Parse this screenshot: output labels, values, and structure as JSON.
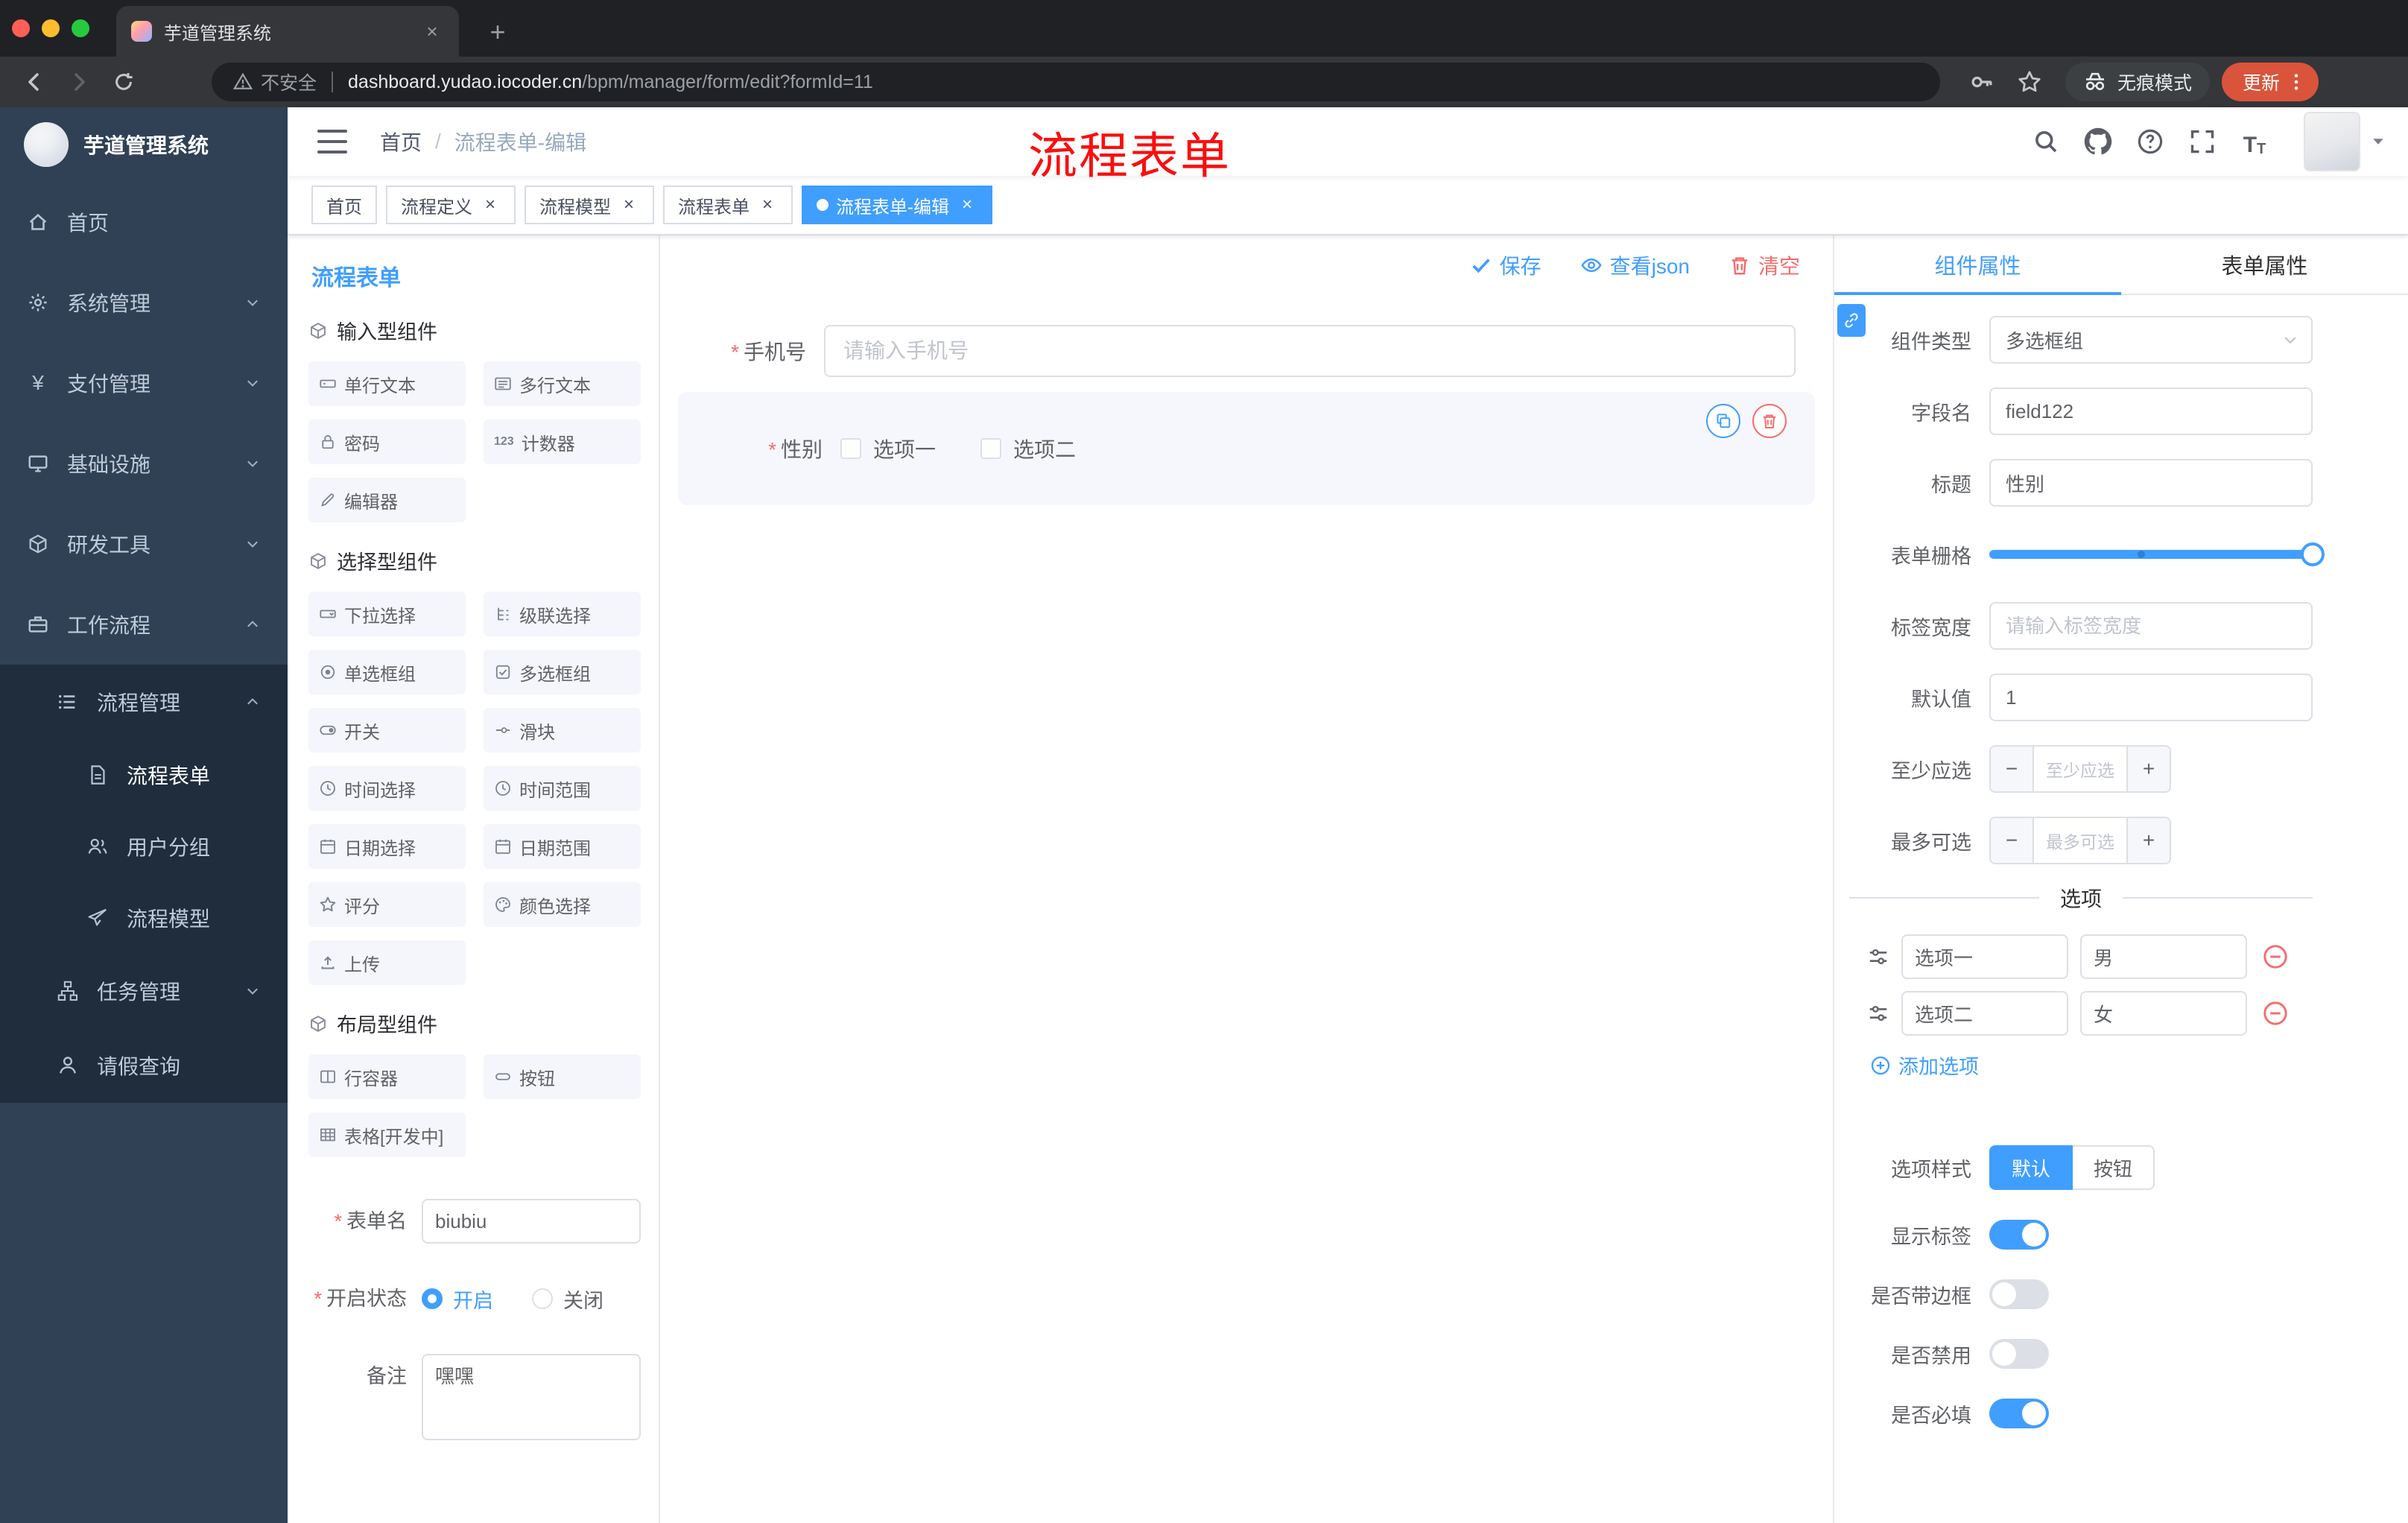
{
  "colors": {
    "accent": "#409eff",
    "danger": "#f56c6c",
    "annotation_red": "#fb0e0e",
    "sidebar_bg": "#304156",
    "submenu_bg": "#1f2d3d",
    "update_pill": "#d9543b"
  },
  "glyphs": {
    "plus": "+",
    "minus": "−",
    "close": "×",
    "slash": "/",
    "counter": "123",
    "font_large": "T",
    "font_small": "T"
  },
  "browser": {
    "tab": {
      "title": "芋道管理系统"
    },
    "address": {
      "security": "不安全",
      "domain": "dashboard.yudao.iocoder.cn",
      "path": "/bpm/manager/form/edit?formId=11"
    },
    "incognito_label": "无痕模式",
    "update_label": "更新"
  },
  "sidebar": {
    "logo_title": "芋道管理系统",
    "items": [
      {
        "label": "首页"
      },
      {
        "label": "系统管理"
      },
      {
        "label": "支付管理"
      },
      {
        "label": "基础设施"
      },
      {
        "label": "研发工具"
      },
      {
        "label": "工作流程"
      }
    ],
    "submenu": {
      "manage": {
        "label": "流程管理",
        "children": [
          {
            "label": "流程表单"
          },
          {
            "label": "用户分组"
          },
          {
            "label": "流程模型"
          }
        ]
      },
      "task": {
        "label": "任务管理"
      },
      "leave": {
        "label": "请假查询"
      }
    }
  },
  "header": {
    "breadcrumb": [
      "首页",
      "流程表单-编辑"
    ],
    "annotation": "流程表单"
  },
  "tags": [
    {
      "label": "首页"
    },
    {
      "label": "流程定义"
    },
    {
      "label": "流程模型"
    },
    {
      "label": "流程表单"
    },
    {
      "label": "流程表单-编辑"
    }
  ],
  "components_panel": {
    "title": "流程表单",
    "groups": [
      {
        "title": "输入型组件",
        "items": [
          "单行文本",
          "多行文本",
          "密码",
          "计数器",
          "编辑器"
        ]
      },
      {
        "title": "选择型组件",
        "items": [
          "下拉选择",
          "级联选择",
          "单选框组",
          "多选框组",
          "开关",
          "滑块",
          "时间选择",
          "时间范围",
          "日期选择",
          "日期范围",
          "评分",
          "颜色选择",
          "上传"
        ]
      },
      {
        "title": "布局型组件",
        "items": [
          "行容器",
          "按钮",
          "表格[开发中]"
        ]
      }
    ],
    "meta": {
      "name_label": "表单名",
      "name_value": "biubiu",
      "status_label": "开启状态",
      "status_options": [
        "开启",
        "关闭"
      ],
      "status_value": "开启",
      "remark_label": "备注",
      "remark_value": "嘿嘿"
    }
  },
  "canvas": {
    "actions": {
      "save": "保存",
      "view_json": "查看json",
      "clear": "清空"
    },
    "phone_field": {
      "label": "手机号",
      "placeholder": "请输入手机号",
      "required": true
    },
    "gender_field": {
      "label": "性别",
      "required": true,
      "options": [
        "选项一",
        "选项二"
      ],
      "selected": true
    }
  },
  "props": {
    "tabs": [
      "组件属性",
      "表单属性"
    ],
    "component_type": {
      "label": "组件类型",
      "value": "多选框组"
    },
    "field_name": {
      "label": "字段名",
      "value": "field122"
    },
    "title": {
      "label": "标题",
      "value": "性别"
    },
    "grid": {
      "label": "表单栅格",
      "value": 24,
      "max": 24
    },
    "label_width": {
      "label": "标签宽度",
      "placeholder": "请输入标签宽度"
    },
    "default_value": {
      "label": "默认值",
      "value": "1"
    },
    "min_select": {
      "label": "至少应选",
      "placeholder": "至少应选"
    },
    "max_select": {
      "label": "最多可选",
      "placeholder": "最多可选"
    },
    "options_title": "选项",
    "options": [
      {
        "label": "选项一",
        "value": "男"
      },
      {
        "label": "选项二",
        "value": "女"
      }
    ],
    "add_option": "添加选项",
    "option_style": {
      "label": "选项样式",
      "choices": [
        "默认",
        "按钮"
      ],
      "active": "默认"
    },
    "switches": [
      {
        "label": "显示标签",
        "on": true
      },
      {
        "label": "是否带边框",
        "on": false
      },
      {
        "label": "是否禁用",
        "on": false
      },
      {
        "label": "是否必填",
        "on": true
      }
    ]
  }
}
